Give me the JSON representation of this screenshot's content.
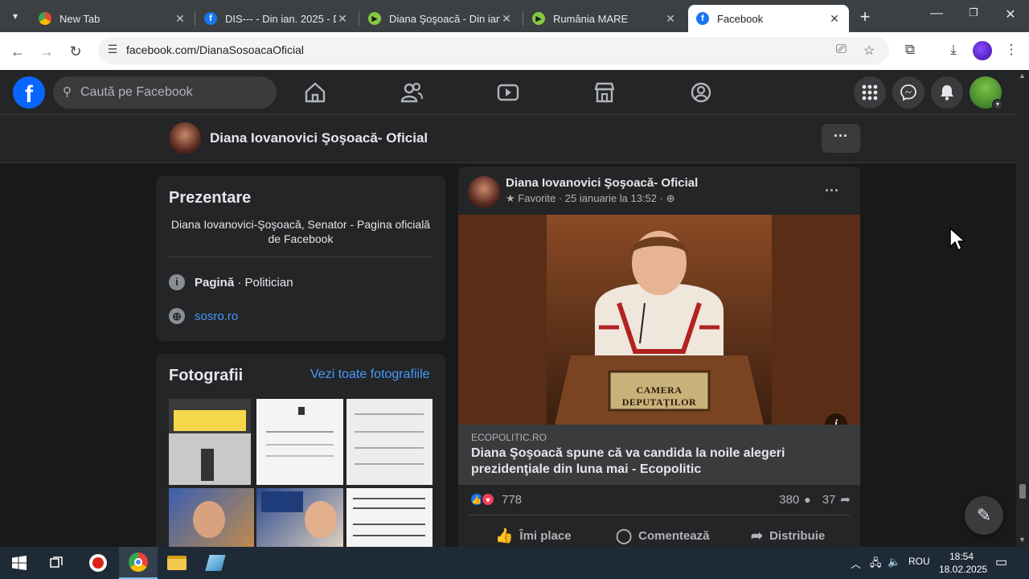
{
  "browser": {
    "tabs": [
      {
        "title": "New Tab",
        "favicon": "chrome-icon",
        "active": false
      },
      {
        "title": "DIS--- - Din ian. 2025 - D",
        "favicon": "facebook-icon",
        "active": false
      },
      {
        "title": "Diana Şoşoacă - Din ianu",
        "favicon": "rumble-icon",
        "active": false
      },
      {
        "title": "Rumânia MARE",
        "favicon": "rumble-icon",
        "active": false
      },
      {
        "title": "Facebook",
        "favicon": "facebook-icon",
        "active": true
      }
    ],
    "url": "facebook.com/DianaSosoacaOficial"
  },
  "fb": {
    "search_placeholder": "Caută pe Facebook"
  },
  "page": {
    "name": "Diana Iovanovici Şoşoacă- Oficial"
  },
  "intro": {
    "title": "Prezentare",
    "description": "Diana Iovanovici-Şoşoacă, Senator - Pagina oficială de Facebook",
    "category_bold": "Pagină",
    "category_rest": " · Politician",
    "website": "sosro.ro"
  },
  "photos": {
    "title": "Fotografii",
    "see_all": "Vezi toate fotografiile"
  },
  "post": {
    "author": "Diana Iovanovici Şoşoacă- Oficial",
    "meta": "Favorite · 25 ianuarie la 13:52 ·",
    "image_caption": "CAMERA DEPUTAŢILOR",
    "link_domain": "ECOPOLITIC.RO",
    "link_title": "Diana Şoşoacă spune că va candida la noile alegeri prezidenţiale din luna mai - Ecopolitic",
    "reactions": "778",
    "comments": "380",
    "shares": "37",
    "actions": {
      "like": "Îmi place",
      "comment": "Comentează",
      "share": "Distribuie"
    }
  },
  "taskbar": {
    "lang": "ROU",
    "time": "18:54",
    "date": "18.02.2025"
  },
  "colors": {
    "fb_blue": "#0866ff",
    "link_blue": "#4599ff",
    "card_bg": "#242526",
    "page_bg": "#18191a"
  }
}
